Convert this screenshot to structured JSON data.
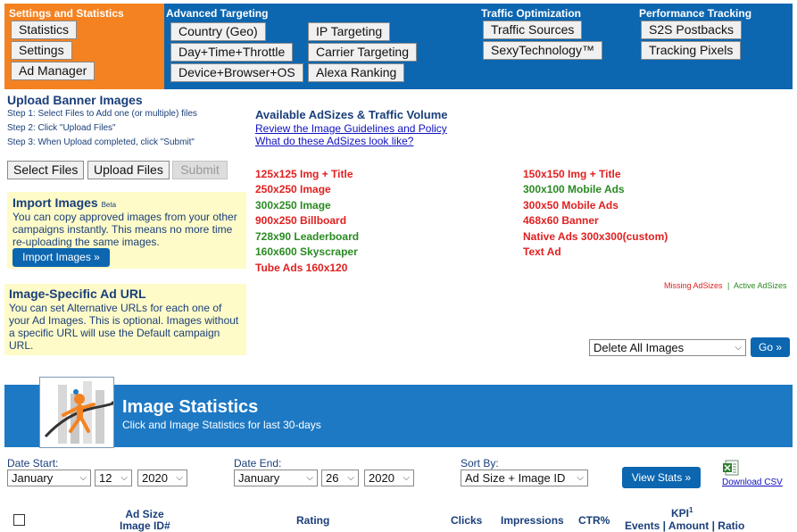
{
  "nav": {
    "sections": [
      {
        "title": "Settings and Statistics",
        "buttons": [
          "Statistics",
          "Settings",
          "Ad Manager"
        ]
      },
      {
        "title": "Advanced Targeting",
        "buttons": [
          "Country (Geo)",
          "Day+Time+Throttle",
          "Device+Browser+OS",
          "IP Targeting",
          "Carrier Targeting",
          "Alexa Ranking"
        ]
      },
      {
        "title": "Traffic Optimization",
        "buttons": [
          "Traffic Sources",
          "SexyTechnology™"
        ]
      },
      {
        "title": "Performance Tracking",
        "buttons": [
          "S2S Postbacks",
          "Tracking Pixels"
        ]
      }
    ]
  },
  "upload": {
    "title": "Upload Banner Images",
    "steps": [
      "Step 1: Select Files to Add one (or multiple) files",
      "Step 2: Click \"Upload Files\"",
      "Step 3: When Upload completed, click \"Submit\""
    ],
    "buttons": {
      "select": "Select Files",
      "upload": "Upload Files",
      "submit": "Submit"
    }
  },
  "import_box": {
    "title": "Import Images",
    "badge": "Beta",
    "text": "You can copy approved images from your other campaigns instantly. This means no more time re-uploading the same images.",
    "button": "Import Images »"
  },
  "url_box": {
    "title": "Image-Specific Ad URL",
    "text": "You can set Alternative URLs for each one of your Ad Images. This is optional. Images without a specific URL will use the Default campaign URL."
  },
  "adsizes": {
    "title": "Available AdSizes & Traffic Volume",
    "links": [
      "Review the Image Guidelines and Policy",
      "What do these AdSizes look like?"
    ],
    "left": [
      {
        "label": "125x125 Img + Title",
        "status": "missing"
      },
      {
        "label": "250x250 Image",
        "status": "missing"
      },
      {
        "label": "300x250 Image",
        "status": "active"
      },
      {
        "label": "900x250 Billboard",
        "status": "missing"
      },
      {
        "label": "728x90 Leaderboard",
        "status": "active"
      },
      {
        "label": "160x600 Skyscraper",
        "status": "active"
      },
      {
        "label": "Tube Ads 160x120",
        "status": "missing"
      }
    ],
    "right": [
      {
        "label": "150x150 Img + Title",
        "status": "missing"
      },
      {
        "label": "300x100 Mobile Ads",
        "status": "active"
      },
      {
        "label": "300x50 Mobile Ads",
        "status": "missing"
      },
      {
        "label": "468x60 Banner",
        "status": "missing"
      },
      {
        "label": "Native Ads 300x300(custom)",
        "status": "missing"
      },
      {
        "label": "Text Ad",
        "status": "missing"
      }
    ],
    "legend": {
      "missing": "Missing AdSizes",
      "separator": "|",
      "active": "Active AdSizes"
    },
    "colors": {
      "missing": "#e02020",
      "active": "#2a8a22"
    }
  },
  "bulk": {
    "selected": "Delete All Images",
    "go": "Go »"
  },
  "stats": {
    "title": "Image Statistics",
    "subtitle": "Click and Image Statistics for last 30-days",
    "date_start_label": "Date Start:",
    "date_end_label": "Date End:",
    "start": {
      "month": "January",
      "day": "12",
      "year": "2020"
    },
    "end": {
      "month": "January",
      "day": "26",
      "year": "2020"
    },
    "sort_label": "Sort By:",
    "sort_value": "Ad Size + Image ID",
    "view_button": "View Stats »",
    "download": "Download CSV",
    "columns": {
      "adsize": "Ad Size",
      "imageid": "Image ID#",
      "rating": "Rating",
      "clicks": "Clicks",
      "impressions": "Impressions",
      "ctr": "CTR%",
      "kpi": "KPI",
      "kpi_sup": "1",
      "kpi_sub": "Events | Amount | Ratio"
    }
  }
}
